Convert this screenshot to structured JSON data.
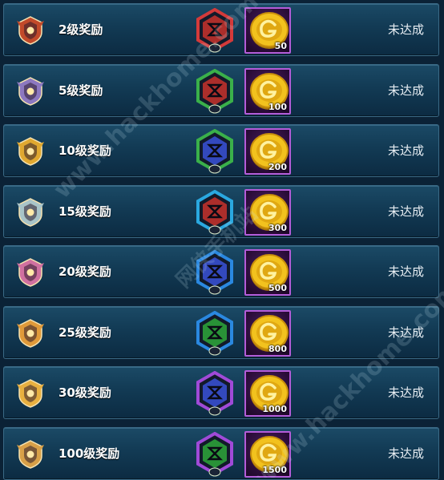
{
  "rows": [
    {
      "title": "2级奖励",
      "count": "50",
      "status": "未达成",
      "rank_color": "#c24a2a",
      "gem_frame": "#d33a3a",
      "gem_color": "#c8322c",
      "gem_roman": "I",
      "rank_icon": "bronze-rank-icon",
      "gem_icon": "red-rune-gem-icon"
    },
    {
      "title": "5级奖励",
      "count": "100",
      "status": "未达成",
      "rank_color": "#8c78c0",
      "gem_frame": "#3ab04a",
      "gem_color": "#c8322c",
      "gem_roman": "II",
      "rank_icon": "silver-rank-icon",
      "gem_icon": "red-rune-gem-icon"
    },
    {
      "title": "10级奖励",
      "count": "200",
      "status": "未达成",
      "rank_color": "#e0a830",
      "gem_frame": "#3ab04a",
      "gem_color": "#3a52d8",
      "gem_roman": "I",
      "rank_icon": "gold-rank-icon",
      "gem_icon": "blue-rune-gem-icon"
    },
    {
      "title": "15级奖励",
      "count": "300",
      "status": "未达成",
      "rank_color": "#a8c4c8",
      "gem_frame": "#2aa8e0",
      "gem_color": "#c8322c",
      "gem_roman": "I",
      "rank_icon": "platinum-rank-icon",
      "gem_icon": "red-rune-gem-icon"
    },
    {
      "title": "20级奖励",
      "count": "500",
      "status": "未达成",
      "rank_color": "#d070a0",
      "gem_frame": "#2a88e0",
      "gem_color": "#3a52d8",
      "gem_roman": "IV",
      "rank_icon": "diamond-rank-icon",
      "gem_icon": "blue-rune-gem-icon"
    },
    {
      "title": "25级奖励",
      "count": "800",
      "status": "未达成",
      "rank_color": "#e09a3a",
      "gem_frame": "#2a88e0",
      "gem_color": "#2ea83a",
      "gem_roman": "IV",
      "rank_icon": "star-rank-icon",
      "gem_icon": "green-rune-gem-icon"
    },
    {
      "title": "30级奖励",
      "count": "1000",
      "status": "未达成",
      "rank_color": "#e8b040",
      "gem_frame": "#a04ad8",
      "gem_color": "#3a52d8",
      "gem_roman": "I",
      "rank_icon": "master-rank-icon",
      "gem_icon": "blue-rune-gem-icon"
    },
    {
      "title": "100级奖励",
      "count": "1500",
      "status": "未达成",
      "rank_color": "#d8a048",
      "gem_frame": "#a04ad8",
      "gem_color": "#2ea83a",
      "gem_roman": "VI",
      "rank_icon": "king-rank-icon",
      "gem_icon": "green-rune-gem-icon"
    }
  ],
  "coin_icon": "gold-coin-icon",
  "watermark": [
    "www.hackhome.com",
    "网侠手机站",
    "www.hackhome.com"
  ]
}
